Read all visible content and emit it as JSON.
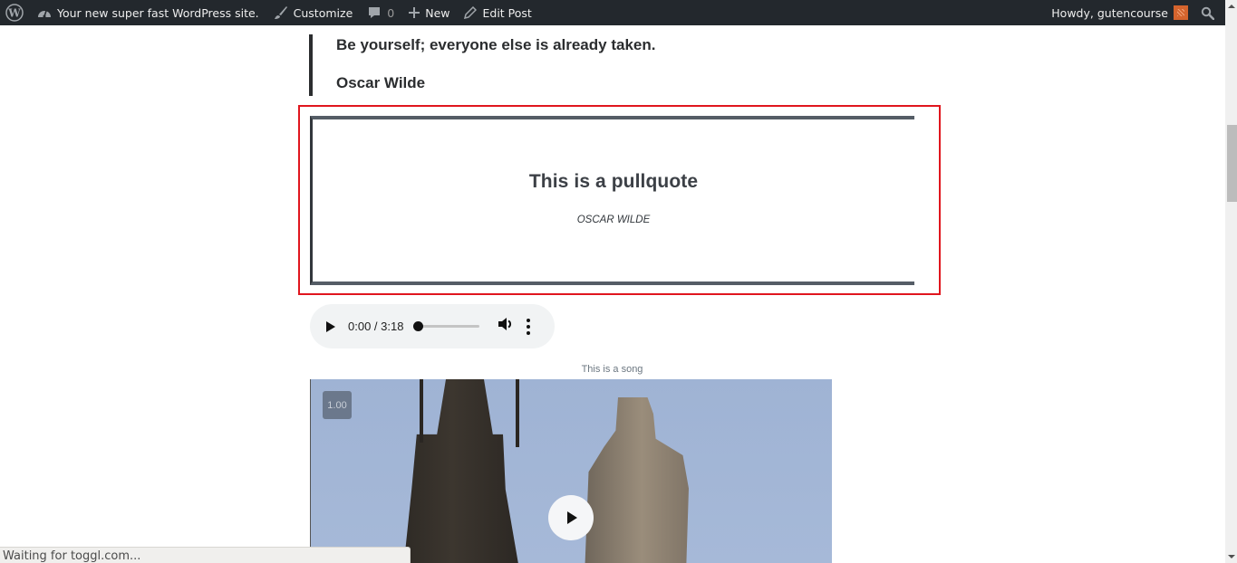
{
  "adminbar": {
    "site_name": "Your new super fast WordPress site.",
    "customize_label": "Customize",
    "comments_count": "0",
    "new_label": "New",
    "edit_post_label": "Edit Post",
    "greeting": "Howdy, gutencourse",
    "icons": {
      "logo": "wordpress-logo-icon",
      "site": "dashboard-gauge-icon",
      "customize": "paintbrush-icon",
      "comments": "comment-bubble-icon",
      "new": "plus-icon",
      "edit": "pencil-icon",
      "search": "search-icon"
    },
    "colors": {
      "background": "#23282d",
      "text": "#eeeeee",
      "avatar": "#d5642d"
    }
  },
  "content": {
    "blockquote": {
      "text": "Be yourself; everyone else is already taken.",
      "citation": "Oscar Wilde"
    },
    "pullquote": {
      "text": "This is a pullquote",
      "citation": "Oscar Wilde",
      "highlight_color": "#e0161e"
    },
    "audio": {
      "time_display": "0:00 / 3:18",
      "current_time": "0:00",
      "duration": "3:18",
      "progress": 0,
      "caption": "This is a song"
    },
    "video": {
      "playback_speed": "1.00"
    }
  },
  "statusbar": {
    "text": "Waiting for toggl.com..."
  }
}
